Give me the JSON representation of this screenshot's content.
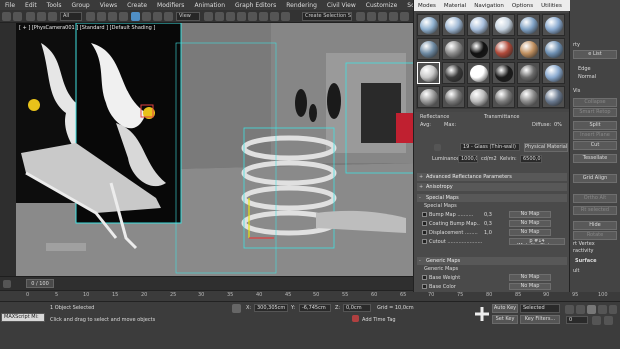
{
  "menu": [
    "File",
    "Edit",
    "Tools",
    "Group",
    "Views",
    "Create",
    "Modifiers",
    "Animation",
    "Graph Editors",
    "Rendering",
    "Civil View",
    "Customize",
    "Scripting"
  ],
  "toolbar": {
    "filter": "All",
    "refcoord": "View",
    "selection_set": "Create Selection Se"
  },
  "viewport": {
    "label": "[ + ] [PhysCamera001 ] [Standard ] [Default Shading ]"
  },
  "timeline": {
    "slider": "0 / 100"
  },
  "ruler_ticks": [
    "0",
    "5",
    "10",
    "15",
    "20",
    "25",
    "30",
    "35",
    "40",
    "45",
    "50",
    "55",
    "60",
    "65",
    "70",
    "75",
    "80",
    "85",
    "90",
    "95",
    "100"
  ],
  "status": {
    "maxscript": "MAXScript Mi:",
    "selected": "1 Object Selected",
    "prompt": "Click and drag to select and move objects",
    "x_label": "X:",
    "x_val": "300,305cm",
    "y_label": "Y:",
    "y_val": "-6,745cm",
    "z_label": "Z:",
    "z_val": "0,0cm",
    "grid": "Grid = 10,0cm",
    "add_time_tag": "Add Time Tag",
    "autokey": "Auto Key",
    "selected_dd": "Selected",
    "set_key": "Set Key",
    "key_filters": "Key Filters...",
    "frame": "0"
  },
  "mat_editor": {
    "menu": [
      "Modes",
      "Material",
      "Navigation",
      "Options",
      "Utilities"
    ],
    "slot_colors": [
      "#8fb0cf",
      "#9fb8d4",
      "#a7bedb",
      "#c6d3e0",
      "#7fa1c4",
      "#8aaad0",
      "#6e8aa3",
      "#8c8c8c",
      "#111111",
      "#b04a3a",
      "#c09060",
      "#6e90b3",
      "#c8c8c8",
      "#3a3a3a",
      "#ffffff",
      "#1a1a1a",
      "#6a6a6a",
      "#8aaad0",
      "#9a9a9a",
      "#7a7a7a",
      "#bcbcbc",
      "#7c7c7c",
      "#8c8c8c",
      "#6a7a90"
    ],
    "reflectance": "Reflectance",
    "transmittance": "Transmittance",
    "avg": "Avg:",
    "max": "Max:",
    "diffuse": "Diffuse:",
    "diffuse_val": "0%",
    "material_name": "19 - Glass (Thin-wall)",
    "material_type": "Physical Material",
    "luminance_label": "Luminance:",
    "luminance_val": "1000,0",
    "luminance_unit": "cd/m2",
    "kelvin_label": "Kelvin:",
    "kelvin_val": "6500,0",
    "sections": [
      "Advanced Reflectance Parameters",
      "Anisotropy",
      "Special Maps",
      "Generic Maps",
      "Surface"
    ],
    "special_maps": {
      "title": "Special Maps",
      "rows": [
        {
          "label": "Bump Map ..........",
          "val": "0,3",
          "map": "No Map"
        },
        {
          "label": "Coating Bump Map..",
          "val": "0,3",
          "map": "No Map"
        },
        {
          "label": "Displacement ........",
          "val": "1,0",
          "map": "No Map"
        },
        {
          "label": "Cutout ......................",
          "val": "",
          "map": "p #14 (Metallic_Plate.p"
        }
      ]
    },
    "generic_maps": {
      "title": "Generic Maps",
      "rows": [
        {
          "label": "Base Weight",
          "map": "No Map"
        },
        {
          "label": "Base Color",
          "map": "No Map"
        }
      ]
    }
  },
  "cmd_panel": {
    "items": [
      "rty",
      "e List",
      "Edge",
      "Normal",
      "Vis",
      "Collapse",
      "Smart Retop",
      "Split",
      "Insert Plane",
      "Cut",
      "Tessellate",
      "Grid Align",
      "Ortho Alt",
      "Rt selected",
      "Hide",
      "Rotate",
      "rt Vertex",
      "ractivity",
      "Surface",
      "ult"
    ]
  }
}
